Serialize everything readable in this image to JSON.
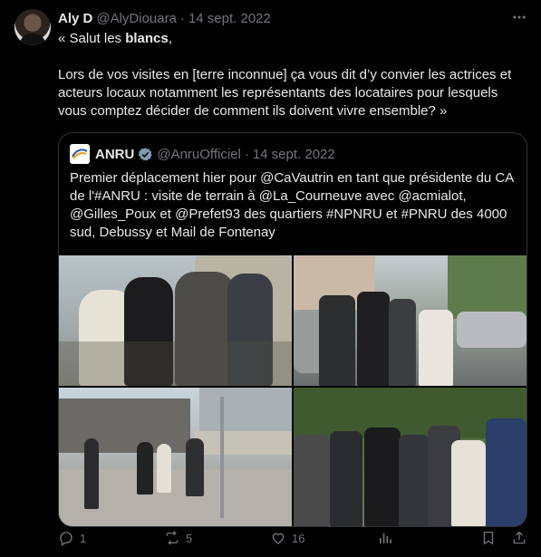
{
  "author": {
    "name": "Aly D",
    "handle": "@AlyDiouara",
    "separator": "·",
    "date": "14 sept. 2022"
  },
  "tweet": {
    "line1_prefix": "« Salut les ",
    "line1_bold": "blancs",
    "line1_suffix": ",",
    "paragraph2": "Lors de vos visites en [terre inconnue] ça vous dit d’y convier les actrices et acteurs locaux notamment les représentants des locataires pour lesquels vous comptez décider de comment ils doivent vivre ensemble? »"
  },
  "quoted": {
    "name": "ANRU",
    "handle": "@AnruOfficiel",
    "separator": "·",
    "date": "14 sept. 2022",
    "text": "Premier déplacement hier pour @CaVautrin en tant que présidente du CA de l'#ANRU : visite de terrain à @La_Courneuve avec @acmialot, @Gilles_Poux et @Prefet93 des quartiers #NPNRU et #PNRU des 4000 sud, Debussy et Mail de Fontenay"
  },
  "actions": {
    "reply_count": "1",
    "retweet_count": "5",
    "like_count": "16",
    "views_count": "",
    "bookmark_count": ""
  },
  "colors": {
    "background": "#000000",
    "text": "#e7e9ea",
    "muted": "#71767b",
    "border": "#2f3336",
    "verified": "#829aab"
  }
}
